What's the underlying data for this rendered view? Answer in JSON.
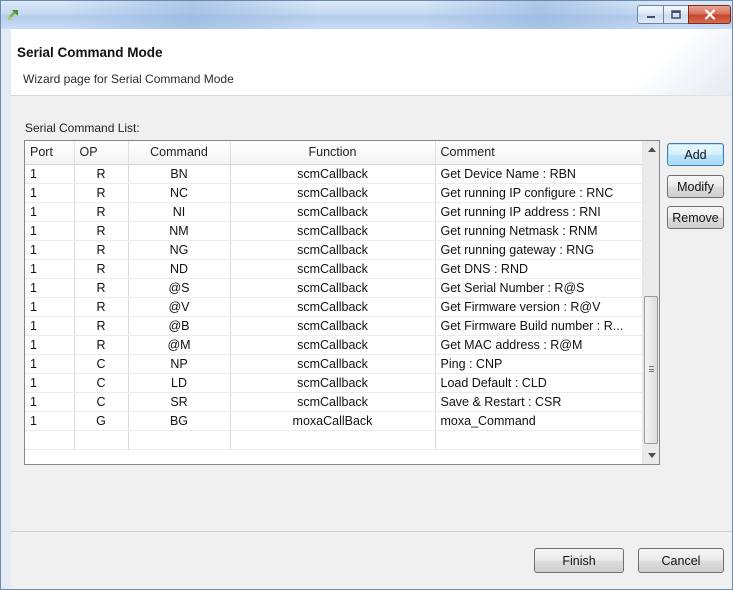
{
  "window": {
    "title": "",
    "minimize_icon": "minimize-icon",
    "maximize_icon": "maximize-icon",
    "close_icon": "close-icon"
  },
  "header": {
    "title": "Serial Command Mode",
    "subtitle": "Wizard page for Serial Command Mode"
  },
  "list_label": "Serial Command List:",
  "table": {
    "columns": [
      "Port",
      "OP",
      "Command",
      "Function",
      "Comment"
    ],
    "rows": [
      {
        "port": "1",
        "op": "R",
        "command": "BN",
        "function": "scmCallback",
        "comment": "Get Device Name : RBN"
      },
      {
        "port": "1",
        "op": "R",
        "command": "NC",
        "function": "scmCallback",
        "comment": "Get running IP configure : RNC"
      },
      {
        "port": "1",
        "op": "R",
        "command": "NI",
        "function": "scmCallback",
        "comment": "Get running IP address : RNI"
      },
      {
        "port": "1",
        "op": "R",
        "command": "NM",
        "function": "scmCallback",
        "comment": "Get running Netmask : RNM"
      },
      {
        "port": "1",
        "op": "R",
        "command": "NG",
        "function": "scmCallback",
        "comment": "Get running gateway : RNG"
      },
      {
        "port": "1",
        "op": "R",
        "command": "ND",
        "function": "scmCallback",
        "comment": "Get DNS : RND"
      },
      {
        "port": "1",
        "op": "R",
        "command": "@S",
        "function": "scmCallback",
        "comment": "Get Serial Number : R@S"
      },
      {
        "port": "1",
        "op": "R",
        "command": "@V",
        "function": "scmCallback",
        "comment": "Get Firmware version : R@V"
      },
      {
        "port": "1",
        "op": "R",
        "command": "@B",
        "function": "scmCallback",
        "comment": "Get Firmware Build number : R..."
      },
      {
        "port": "1",
        "op": "R",
        "command": "@M",
        "function": "scmCallback",
        "comment": "Get MAC address : R@M"
      },
      {
        "port": "1",
        "op": "C",
        "command": "NP",
        "function": "scmCallback",
        "comment": "Ping : CNP"
      },
      {
        "port": "1",
        "op": "C",
        "command": "LD",
        "function": "scmCallback",
        "comment": "Load Default : CLD"
      },
      {
        "port": "1",
        "op": "C",
        "command": "SR",
        "function": "scmCallback",
        "comment": "Save & Restart : CSR"
      },
      {
        "port": "1",
        "op": "G",
        "command": "BG",
        "function": "moxaCallBack",
        "comment": "moxa_Command"
      }
    ]
  },
  "side_buttons": {
    "add": "Add",
    "modify": "Modify",
    "remove": "Remove"
  },
  "footer": {
    "finish": "Finish",
    "cancel": "Cancel"
  },
  "colors": {
    "accent": "#3c7fb1",
    "close_button": "#c7442a"
  }
}
